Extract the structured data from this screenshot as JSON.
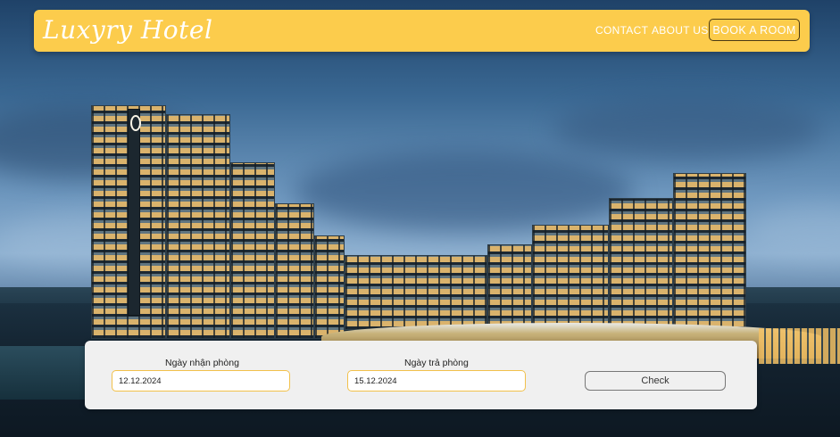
{
  "navbar": {
    "brand": "Luxyry Hotel",
    "links": {
      "contact": "CONTACT",
      "about": "ABOUT US"
    },
    "cta": "BOOK A ROOM",
    "accent_color": "#fccc4c"
  },
  "booking": {
    "checkin_label": "Ngày nhận phòng",
    "checkin_value": "12.12.2024",
    "checkout_label": "Ngày trả phòng",
    "checkout_value": "15.12.2024",
    "check_button": "Check"
  },
  "hero": {
    "image_subject": "hotel-night-photo"
  }
}
